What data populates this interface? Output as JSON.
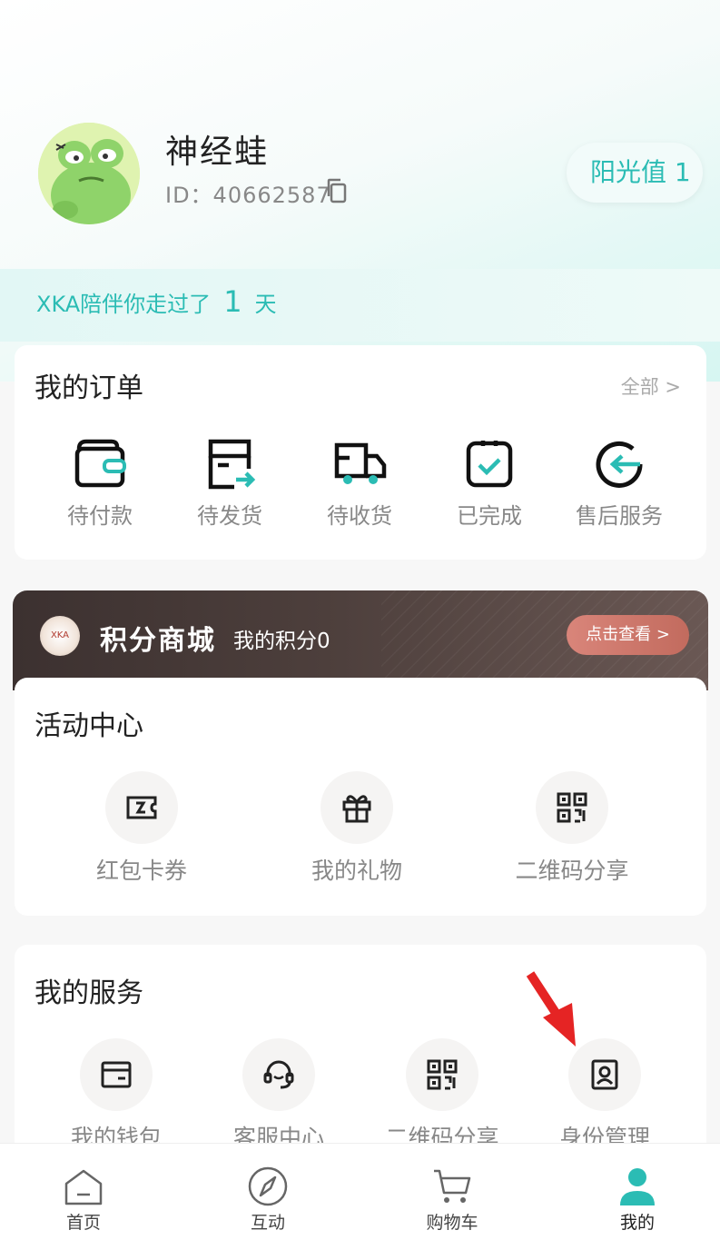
{
  "profile": {
    "name": "神经蛙",
    "id_text": "ID：40662587",
    "sunshine": "阳光值 1"
  },
  "days_banner": {
    "prefix": "XKA陪伴你走过了",
    "count": "1",
    "suffix": "天"
  },
  "orders": {
    "title": "我的订单",
    "view_all": "全部 >",
    "items": [
      {
        "label": "待付款",
        "icon": "wallet-icon"
      },
      {
        "label": "待发货",
        "icon": "box-ship-icon"
      },
      {
        "label": "待收货",
        "icon": "truck-icon"
      },
      {
        "label": "已完成",
        "icon": "check-square-icon"
      },
      {
        "label": "售后服务",
        "icon": "return-icon"
      }
    ]
  },
  "points_mall": {
    "logo": "XKA",
    "title": "积分商城",
    "my_points": "我的积分0",
    "button": "点击查看 >"
  },
  "activity": {
    "title": "活动中心",
    "items": [
      {
        "label": "红包卡券",
        "icon": "coupon-icon"
      },
      {
        "label": "我的礼物",
        "icon": "gift-icon"
      },
      {
        "label": "二维码分享",
        "icon": "qrcode-icon"
      }
    ]
  },
  "services": {
    "title": "我的服务",
    "items": [
      {
        "label": "我的钱包",
        "icon": "wallet-card-icon"
      },
      {
        "label": "客服中心",
        "icon": "headset-icon"
      },
      {
        "label": "二维码分享",
        "icon": "qrcode-icon"
      },
      {
        "label": "身份管理",
        "icon": "id-card-icon"
      }
    ]
  },
  "tabbar": {
    "items": [
      {
        "label": "首页",
        "icon": "home-icon"
      },
      {
        "label": "互动",
        "icon": "compass-icon"
      },
      {
        "label": "购物车",
        "icon": "cart-icon"
      },
      {
        "label": "我的",
        "icon": "user-icon"
      }
    ],
    "active_color": "#2bbcb4"
  },
  "colors": {
    "accent": "#2bbcb4",
    "annotation_arrow": "#e52424"
  }
}
